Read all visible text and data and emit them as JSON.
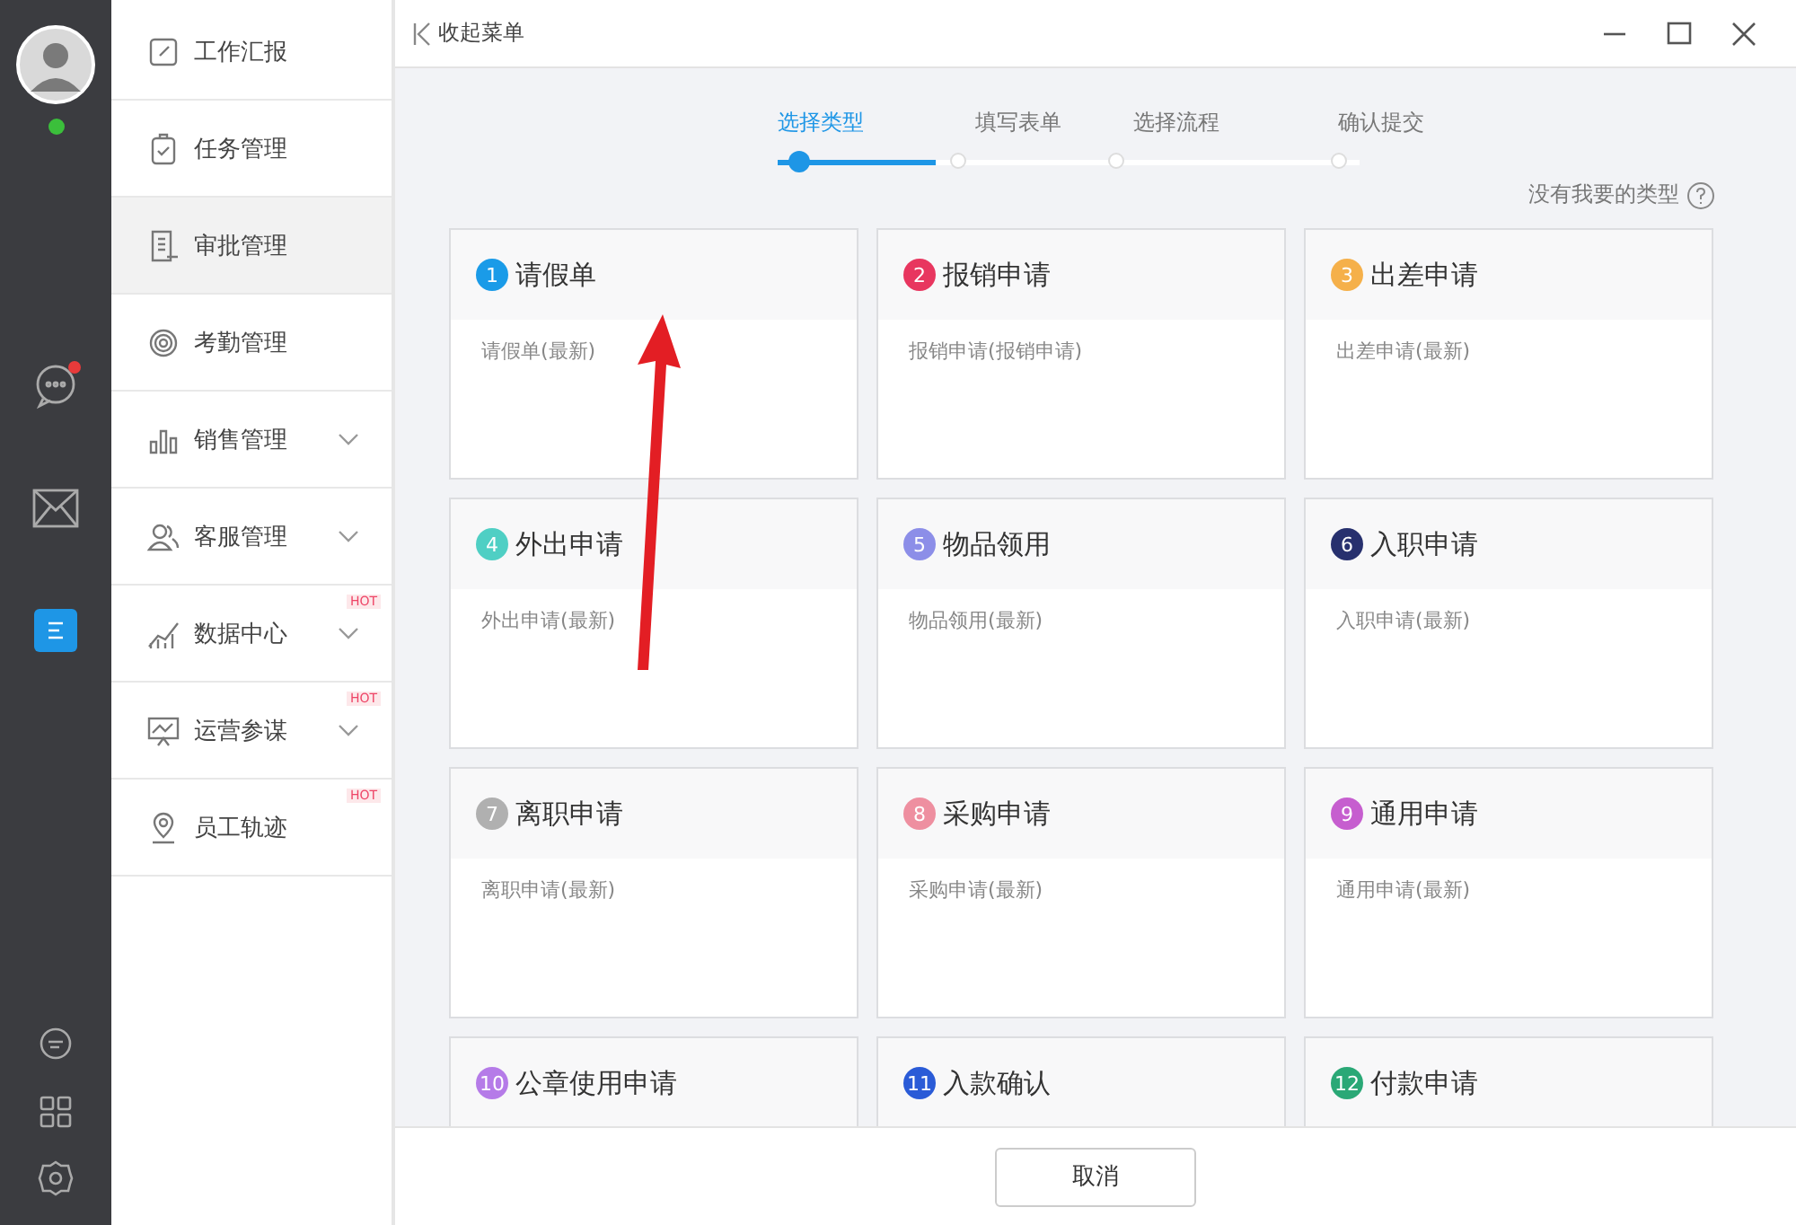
{
  "rail": {
    "online": true,
    "items": [
      {
        "kind": "chat",
        "badge": true,
        "selected": false
      },
      {
        "kind": "mail",
        "badge": false,
        "selected": false
      },
      {
        "kind": "approval",
        "badge": false,
        "selected": true
      }
    ],
    "bottom": [
      {
        "kind": "feedback"
      },
      {
        "kind": "apps"
      },
      {
        "kind": "settings"
      }
    ]
  },
  "menu": {
    "items": [
      {
        "label": "工作汇报",
        "selected": false,
        "expandable": false
      },
      {
        "label": "任务管理",
        "selected": false,
        "expandable": false
      },
      {
        "label": "审批管理",
        "selected": true,
        "expandable": false
      },
      {
        "label": "考勤管理",
        "selected": false,
        "expandable": false
      },
      {
        "label": "销售管理",
        "selected": false,
        "expandable": true
      },
      {
        "label": "客服管理",
        "selected": false,
        "expandable": true
      },
      {
        "label": "数据中心",
        "selected": false,
        "expandable": true,
        "badge": "HOT"
      },
      {
        "label": "运营参谋",
        "selected": false,
        "expandable": true,
        "badge": "HOT"
      },
      {
        "label": "员工轨迹",
        "selected": false,
        "expandable": false,
        "badge": "HOT"
      }
    ]
  },
  "window": {
    "collapse_label": "收起菜单"
  },
  "steps": [
    {
      "label": "选择类型",
      "selected": true
    },
    {
      "label": "填写表单",
      "selected": false
    },
    {
      "label": "选择流程",
      "selected": false
    },
    {
      "label": "确认提交",
      "selected": false
    }
  ],
  "help_link": "没有我要的类型",
  "types": [
    {
      "number": "1",
      "title": "请假单",
      "description": "请假单(最新)",
      "color": "#1a9be8"
    },
    {
      "number": "2",
      "title": "报销申请",
      "description": "报销申请(报销申请)",
      "color": "#e8365f"
    },
    {
      "number": "3",
      "title": "出差申请",
      "description": "出差申请(最新)",
      "color": "#f5b04a"
    },
    {
      "number": "4",
      "title": "外出申请",
      "description": "外出申请(最新)",
      "color": "#4fcfc4"
    },
    {
      "number": "5",
      "title": "物品领用",
      "description": "物品领用(最新)",
      "color": "#8c8ee8"
    },
    {
      "number": "6",
      "title": "入职申请",
      "description": "入职申请(最新)",
      "color": "#27306e"
    },
    {
      "number": "7",
      "title": "离职申请",
      "description": "离职申请(最新)",
      "color": "#b0b0b0"
    },
    {
      "number": "8",
      "title": "采购申请",
      "description": "采购申请(最新)",
      "color": "#ee8fa0"
    },
    {
      "number": "9",
      "title": "通用申请",
      "description": "通用申请(最新)",
      "color": "#c65ecf"
    },
    {
      "number": "10",
      "title": "公章使用申请",
      "color": "#b57be8"
    },
    {
      "number": "11",
      "title": "入款确认",
      "color": "#2a5bd7"
    },
    {
      "number": "12",
      "title": "付款申请",
      "color": "#2aa876"
    }
  ],
  "cancel_button": "取消",
  "annotation": {
    "kind": "arrow"
  }
}
